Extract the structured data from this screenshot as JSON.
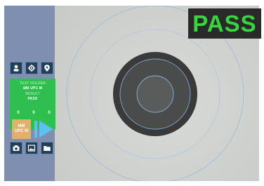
{
  "result": {
    "label": "PASS",
    "color": "#37d63f"
  },
  "toolbar": {
    "top_icons": [
      "user-icon",
      "gear-icon",
      "location-pin-icon"
    ],
    "bottom_icons": [
      "camera-icon",
      "image-icon",
      "folder-icon"
    ]
  },
  "info_panel": {
    "test_label": "TEST HOLDER",
    "test_value": "MM UPC M",
    "result_label": "RESULT",
    "result_value": "PASS",
    "counts": [
      "0",
      "0",
      "0"
    ]
  },
  "mode": {
    "line1": "MM",
    "line2": "UPC M"
  },
  "colors": {
    "accent_green": "#2fbf4f",
    "mode_button": "#e2b06b",
    "panel_blue": "#7f8fb1",
    "icon_button": "#1f3f5a"
  }
}
